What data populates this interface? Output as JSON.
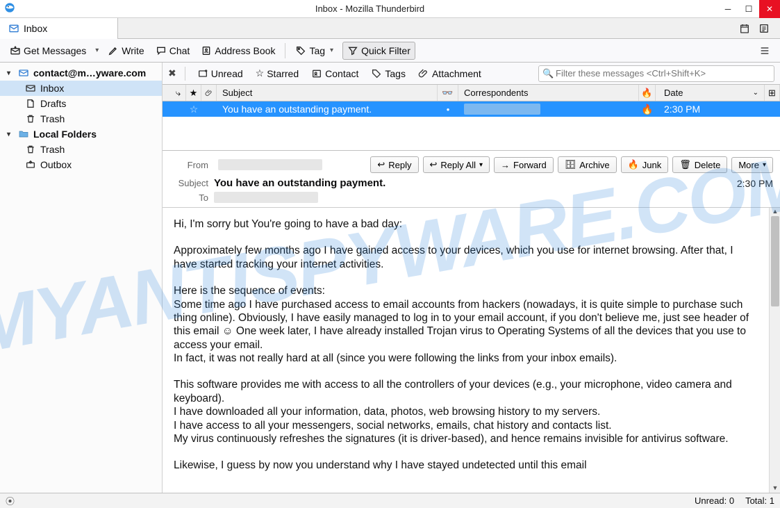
{
  "window": {
    "title": "Inbox - Mozilla Thunderbird"
  },
  "tab": {
    "label": "Inbox"
  },
  "toolbar": {
    "get_messages": "Get Messages",
    "write": "Write",
    "chat": "Chat",
    "address_book": "Address Book",
    "tag": "Tag",
    "quick_filter": "Quick Filter"
  },
  "sidebar": {
    "account": "contact@m…yware.com",
    "items": [
      {
        "label": "Inbox"
      },
      {
        "label": "Drafts"
      },
      {
        "label": "Trash"
      }
    ],
    "local_label": "Local Folders",
    "local_items": [
      {
        "label": "Trash"
      },
      {
        "label": "Outbox"
      }
    ]
  },
  "filterbar": {
    "unread": "Unread",
    "starred": "Starred",
    "contact": "Contact",
    "tags": "Tags",
    "attachment": "Attachment",
    "search_placeholder": "Filter these messages <Ctrl+Shift+K>"
  },
  "columns": {
    "subject": "Subject",
    "correspondents": "Correspondents",
    "date": "Date"
  },
  "message_list": {
    "row": {
      "subject": "You have an outstanding payment.",
      "date": "2:30 PM"
    }
  },
  "header": {
    "from_label": "From",
    "subject_label": "Subject",
    "to_label": "To",
    "subject": "You have an outstanding payment.",
    "date": "2:30 PM"
  },
  "actions": {
    "reply": "Reply",
    "reply_all": "Reply All",
    "forward": "Forward",
    "archive": "Archive",
    "junk": "Junk",
    "delete": "Delete",
    "more": "More"
  },
  "body": {
    "p1": "Hi, I'm sorry but You're going to have a bad day:",
    "p2": "Approximately few months ago I have gained access to your devices, which you use for internet browsing. After that, I have started tracking your internet activities.",
    "p3": "Here is the sequence of events:\nSome time ago I have purchased access to email accounts from hackers (nowadays, it is quite simple to purchase such thing online). Obviously, I have easily managed to log in to your email account, if you don't believe me, just see header of this email ☺ One week later, I have already installed Trojan virus to Operating Systems of all the devices that you use to access your email.\nIn fact, it was not really hard at all (since you were following the links from your inbox emails).",
    "p4": "This software provides me with access to all the controllers of your devices (e.g., your microphone, video camera and keyboard).\nI have downloaded all your information, data, photos, web browsing history to my servers.\nI have access to all your messengers, social networks, emails, chat history and contacts list.\nMy virus continuously refreshes the signatures (it is driver-based), and hence remains invisible for antivirus software.",
    "p5": "Likewise, I guess by now you understand why I have stayed undetected until this email"
  },
  "status": {
    "unread": "Unread: 0",
    "total": "Total: 1"
  },
  "watermark": "MYANTISPYWARE.COM"
}
